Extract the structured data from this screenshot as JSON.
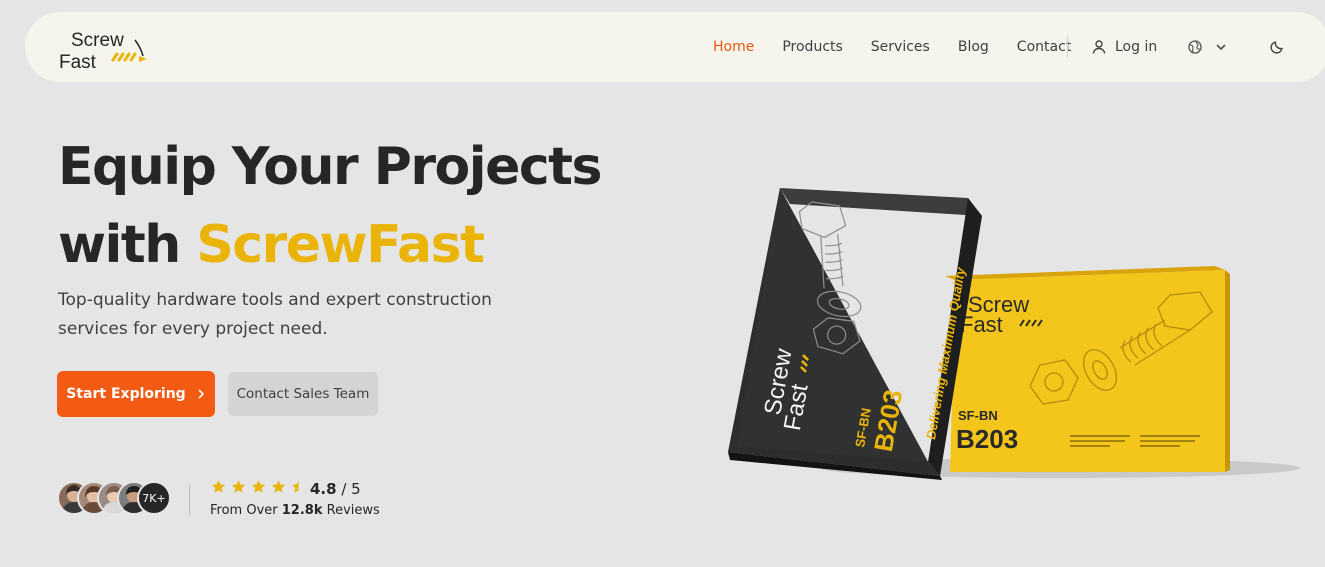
{
  "brand": {
    "logo_line1": "Screw",
    "logo_line2": "Fast"
  },
  "nav": {
    "links": [
      "Home",
      "Products",
      "Services",
      "Blog",
      "Contact"
    ],
    "login_label": "Log in"
  },
  "hero": {
    "title_line1": "Equip Your Projects",
    "title_prefix": "with ",
    "title_accent": "ScrewFast",
    "subtitle": "Top-quality hardware tools and expert construction services for every project need.",
    "primary_cta": "Start Exploring",
    "secondary_cta": "Contact Sales Team"
  },
  "social_proof": {
    "avatar_count_label": "7K+",
    "rating_value": "4.8",
    "rating_max": "/ 5",
    "stars": 4.5,
    "reviews_prefix": "From Over ",
    "reviews_count": "12.8k",
    "reviews_suffix": " Reviews"
  },
  "product_boxes": {
    "dark_box": {
      "code_prefix": "SF-BN",
      "code": "B203",
      "tagline": "Delivering Maximum Quality",
      "logo_line1": "Screw",
      "logo_line2": "Fast"
    },
    "yellow_box": {
      "code_prefix": "SF-BN",
      "code": "B203",
      "logo_line1": "Screw",
      "logo_line2": "Fast"
    }
  },
  "colors": {
    "accent_orange": "#f35b15",
    "brand_yellow": "#eab308",
    "nav_bg": "#f5f5ed",
    "page_bg": "#e5e5e5"
  }
}
